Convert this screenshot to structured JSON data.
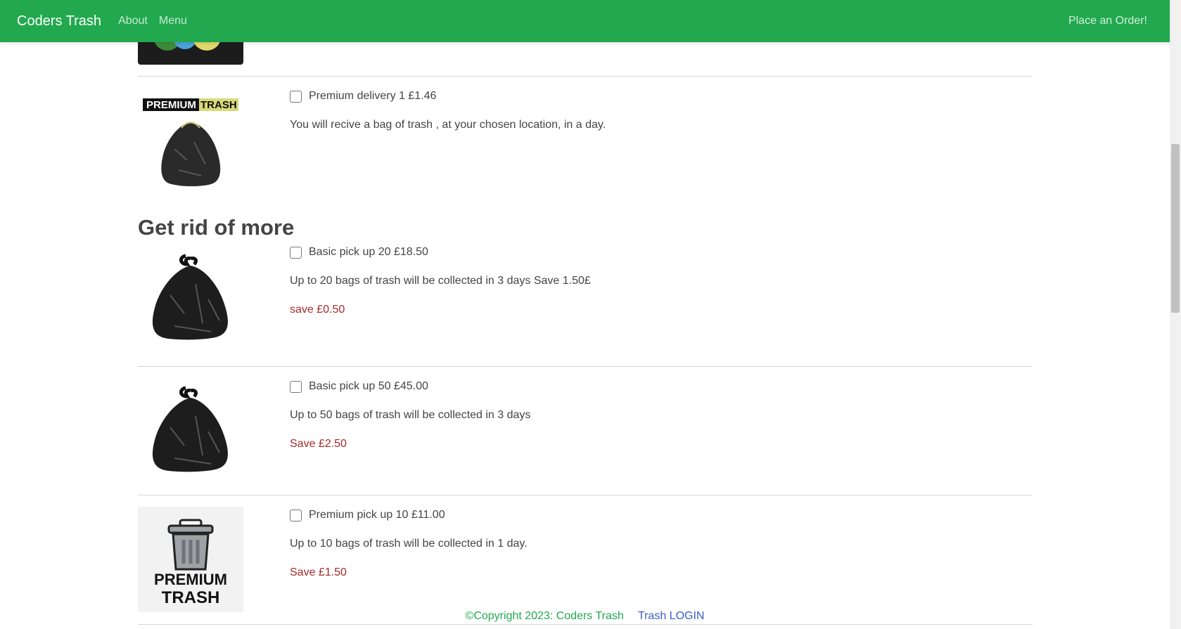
{
  "navbar": {
    "brand": "Coders Trash",
    "links": [
      "About",
      "Menu"
    ],
    "order_link": "Place an Order!"
  },
  "items_top": [
    {
      "option": "Premium delivery 1  £1.46",
      "description": "You will recive a bag of trash , at your chosen location, in a day.",
      "image_logo_text": "PREMIUM TRASH"
    }
  ],
  "section_title": "Get rid of more",
  "items": [
    {
      "option": "Basic pick up 20  £18.50",
      "description": "Up to 20 bags of trash will be collected in 3 days Save 1.50£",
      "save": "save £0.50"
    },
    {
      "option": "Basic pick up 50  £45.00",
      "description": "Up to 50 bags of trash will be collected in 3 days",
      "save": "Save £2.50"
    },
    {
      "option": "Premium pick up 10  £11.00",
      "description": "Up to 10 bags of trash will be collected in 1 day.",
      "save": "Save £1.50",
      "image_logo_text": "PREMIUM TRASH"
    }
  ],
  "footer": {
    "copyright": "©Copyright 2023: Coders Trash",
    "login": "Trash LOGIN"
  },
  "colors": {
    "navbar": "#22a94f",
    "save_text": "#a52a2a",
    "login_link": "#3b5fc0"
  }
}
